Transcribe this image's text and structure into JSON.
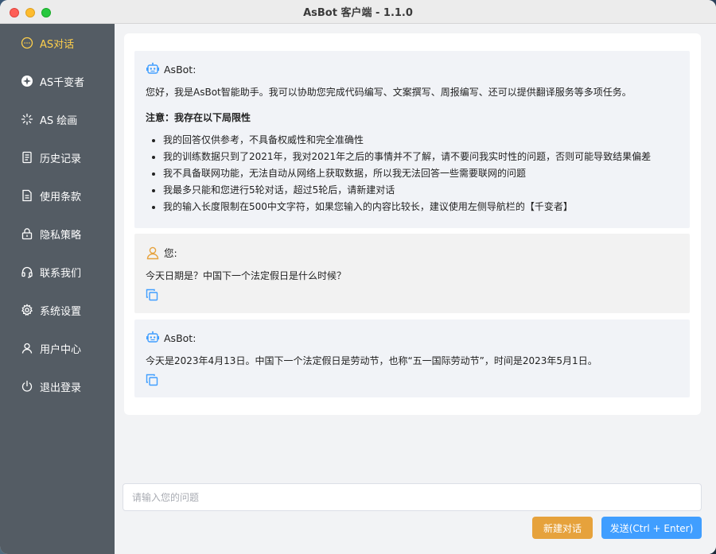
{
  "window": {
    "title": "AsBot 客户端 - 1.1.0"
  },
  "sidebar": {
    "items": [
      {
        "label": "AS对话",
        "icon": "chat-icon",
        "active": true
      },
      {
        "label": "AS千变者",
        "icon": "compass-icon",
        "active": false
      },
      {
        "label": "AS 绘画",
        "icon": "sparkle-icon",
        "active": false
      },
      {
        "label": "历史记录",
        "icon": "history-icon",
        "active": false
      },
      {
        "label": "使用条款",
        "icon": "document-icon",
        "active": false
      },
      {
        "label": "隐私策略",
        "icon": "lock-icon",
        "active": false
      },
      {
        "label": "联系我们",
        "icon": "headset-icon",
        "active": false
      },
      {
        "label": "系统设置",
        "icon": "gear-icon",
        "active": false
      },
      {
        "label": "用户中心",
        "icon": "user-icon",
        "active": false
      },
      {
        "label": "退出登录",
        "icon": "power-icon",
        "active": false
      }
    ],
    "active_color": "#ffd04b",
    "bg_color": "#545c64"
  },
  "chat": {
    "messages": [
      {
        "sender": "AsBot:",
        "role": "bot",
        "intro": "您好，我是AsBot智能助手。我可以协助您完成代码编写、文案撰写、周报编写、还可以提供翻译服务等多项任务。",
        "note_title": "注意：我存在以下局限性",
        "limitations": [
          "我的回答仅供参考，不具备权威性和完全准确性",
          "我的训练数据只到了2021年，我对2021年之后的事情并不了解，请不要问我实时性的问题，否则可能导致结果偏差",
          "我不具备联网功能，无法自动从网络上获取数据，所以我无法回答一些需要联网的问题",
          "我最多只能和您进行5轮对话，超过5轮后，请新建对话",
          "我的输入长度限制在500中文字符，如果您输入的内容比较长，建议使用左侧导航栏的【千变者】"
        ]
      },
      {
        "sender": "您:",
        "role": "user",
        "text": "今天日期是？中国下一个法定假日是什么时候？"
      },
      {
        "sender": "AsBot:",
        "role": "bot",
        "text": "今天是2023年4月13日。中国下一个法定假日是劳动节，也称“五一国际劳动节”，时间是2023年5月1日。"
      }
    ]
  },
  "input": {
    "placeholder": "请输入您的问题",
    "value": ""
  },
  "actions": {
    "new_chat_label": "新建对话",
    "send_label": "发送(Ctrl + Enter)",
    "new_chat_color": "#e6a23c",
    "send_color": "#409eff"
  }
}
